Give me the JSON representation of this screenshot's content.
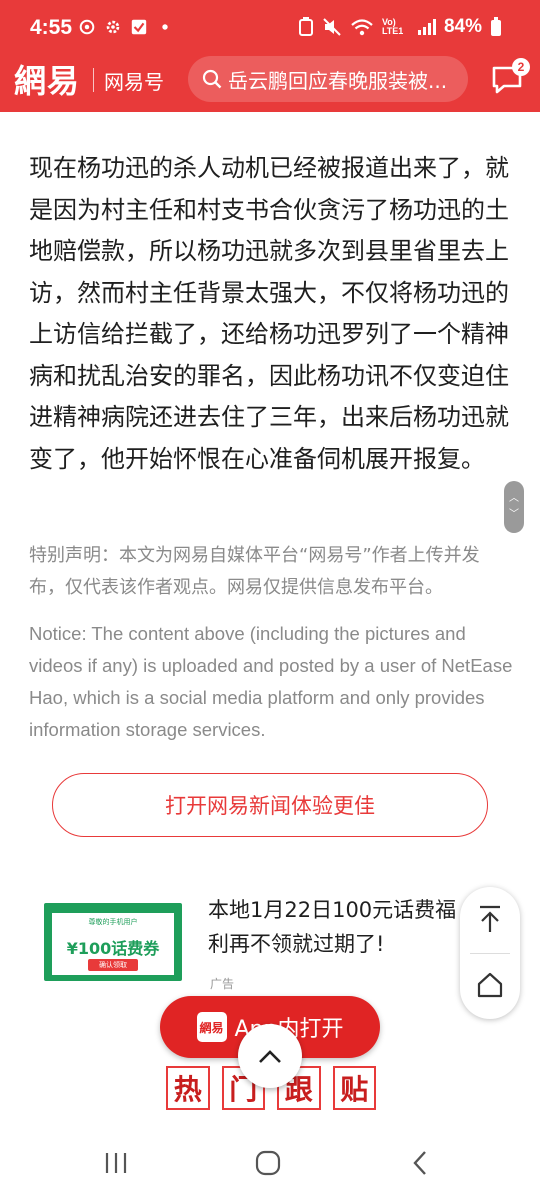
{
  "status_bar": {
    "time": "4:55",
    "battery": "84%",
    "network_label": "Vo) LTE1"
  },
  "header": {
    "logo": "網易",
    "channel": "网易号",
    "search_text": "岳云鹏回应春晚服装被...",
    "message_badge": "2"
  },
  "article": {
    "body": "现在杨功迅的杀人动机已经被报道出来了，就是因为村主任和村支书合伙贪污了杨功迅的土地赔偿款，所以杨功迅就多次到县里省里去上访，然而村主任背景太强大，不仅将杨功迅的上访信给拦截了，还给杨功迅罗列了一个精神病和扰乱治安的罪名，因此杨功讯不仅变迫住进精神病院还进去住了三年，出来后杨功迅就变了，他开始怀恨在心准备伺机展开报复。",
    "disclaimer_cn": "特别声明：本文为网易自媒体平台“网易号”作者上传并发布，仅代表该作者观点。网易仅提供信息发布平台。",
    "notice_en": "Notice: The content above (including the pictures and videos if any) is uploaded and posted by a user of NetEase Hao, which is a social media platform and only provides information storage services."
  },
  "open_app_button": "打开网易新闻体验更佳",
  "ad": {
    "title": "本地1月22日100元话费福利再不领就过期了!",
    "label": "广告",
    "image_top_text": "尊敬的手机用户",
    "image_value": "¥100话费券",
    "image_button": "确认领取"
  },
  "in_app_button": {
    "logo": "網易",
    "label": "App内打开"
  },
  "hot_section": {
    "chars": [
      "热",
      "门",
      "跟",
      "贴"
    ]
  },
  "colors": {
    "brand_red": "#e83a3a",
    "ad_green": "#1e9e5a"
  },
  "icons": [
    "search-icon",
    "message-icon",
    "back-to-top-icon",
    "home-icon",
    "chevron-up-icon",
    "recent-apps-icon",
    "home-nav-icon",
    "back-nav-icon"
  ]
}
